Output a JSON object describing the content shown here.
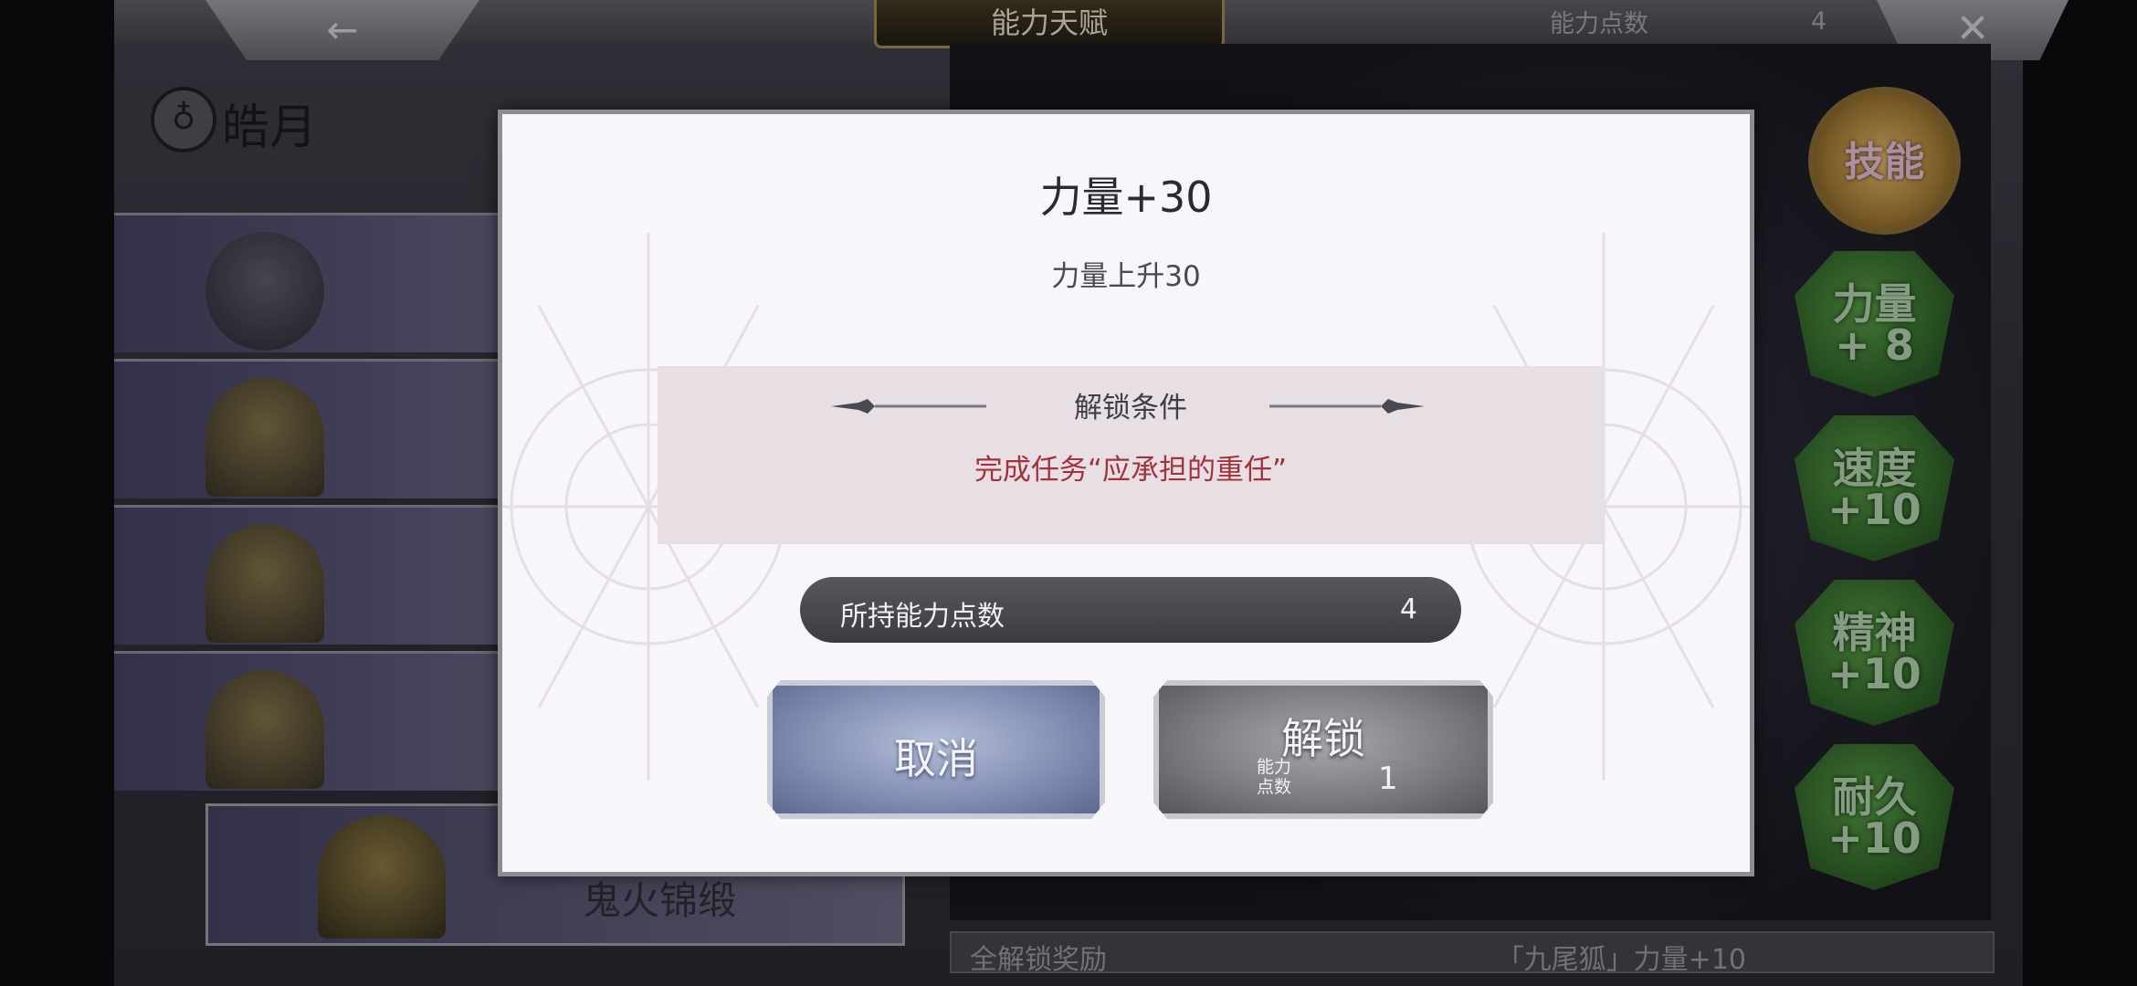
{
  "header": {
    "title": "能力天赋",
    "points_label": "能力点数",
    "points_value": "4",
    "back_icon": "back-arrow-icon",
    "close_icon": "close-icon"
  },
  "character": {
    "name": "皓月"
  },
  "left_list": {
    "bottom_item_label": "鬼火锦缎"
  },
  "right_panel": {
    "skill_label": "技能",
    "gems": [
      {
        "line1": "力量",
        "line2": "+ 8"
      },
      {
        "line1": "速度",
        "line2": "+10"
      },
      {
        "line1": "精神",
        "line2": "+10"
      },
      {
        "line1": "耐久",
        "line2": "+10"
      }
    ]
  },
  "footer": {
    "label": "全解锁奖励",
    "reward": "「九尾狐」力量+10"
  },
  "dialog": {
    "title": "力量+30",
    "description": "力量上升30",
    "condition_title": "解锁条件",
    "condition_text": "完成任务“应承担的重任”",
    "held_points_label": "所持能力点数",
    "held_points_value": "4",
    "cancel_label": "取消",
    "unlock_label": "解锁",
    "cost_label_line1": "能力",
    "cost_label_line2": "点数",
    "cost_value": "1"
  },
  "colors": {
    "condition_text": "#a4323c",
    "dialog_bg": "#f8f6fa",
    "cancel_button": "#8894b8",
    "unlock_button": "#7c7c82",
    "gem_green": "#4e8a3e"
  }
}
